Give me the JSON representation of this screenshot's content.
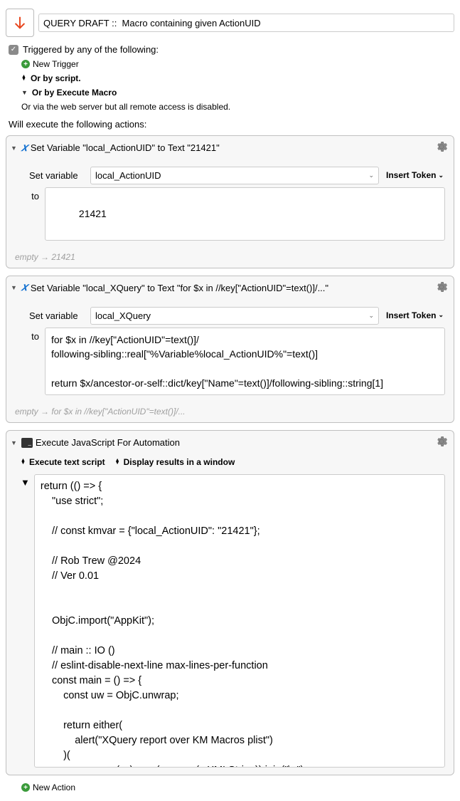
{
  "header": {
    "title": "QUERY DRAFT ::  Macro containing given ActionUID"
  },
  "triggers": {
    "triggered_label": "Triggered by any of the following:",
    "new_trigger": "New Trigger",
    "or_script": "Or by script.",
    "or_execute_macro": "Or by Execute Macro",
    "or_web_server": "Or via the web server but all remote access is disabled."
  },
  "actions_label": "Will execute the following actions:",
  "actions": [
    {
      "title": "Set Variable \"local_ActionUID\" to Text \"21421\"",
      "set_label": "Set variable",
      "var_name": "local_ActionUID",
      "to_label": "to",
      "value": "21421",
      "token_label": "Insert Token",
      "status_prefix": "empty",
      "status_value": "21421"
    },
    {
      "title": "Set Variable \"local_XQuery\" to Text \"for $x in //key[\"ActionUID\"=text()]/...\"",
      "set_label": "Set variable",
      "var_name": "local_XQuery",
      "to_label": "to",
      "value": "for $x in //key[\"ActionUID\"=text()]/\nfollowing-sibling::real[\"%Variable%local_ActionUID%\"=text()]\n\nreturn $x/ancestor-or-self::dict/key[\"Name\"=text()]/following-sibling::string[1]",
      "token_label": "Insert Token",
      "status_prefix": "empty",
      "status_value": "for $x in //key[\"ActionUID\"=text()]/..."
    },
    {
      "title": "Execute JavaScript For Automation",
      "opt_script": "Execute text script",
      "opt_results": "Display results in a window",
      "code": "return (() => {\n    \"use strict\";\n\n    // const kmvar = {\"local_ActionUID\": \"21421\"};\n\n    // Rob Trew @2024\n    // Ver 0.01\n\n\n    ObjC.import(\"AppKit\");\n\n    // main :: IO ()\n    // eslint-disable-next-line max-lines-per-function\n    const main = () => {\n        const uw = ObjC.unwrap;\n\n        return either(\n            alert(\"XQuery report over KM Macros plist\")\n        )(\n            xs => uw(xs).map(x => uw(x.XMLString)).join(\"\\n\")\n        )("
    }
  ],
  "footer": {
    "new_action": "New Action"
  }
}
